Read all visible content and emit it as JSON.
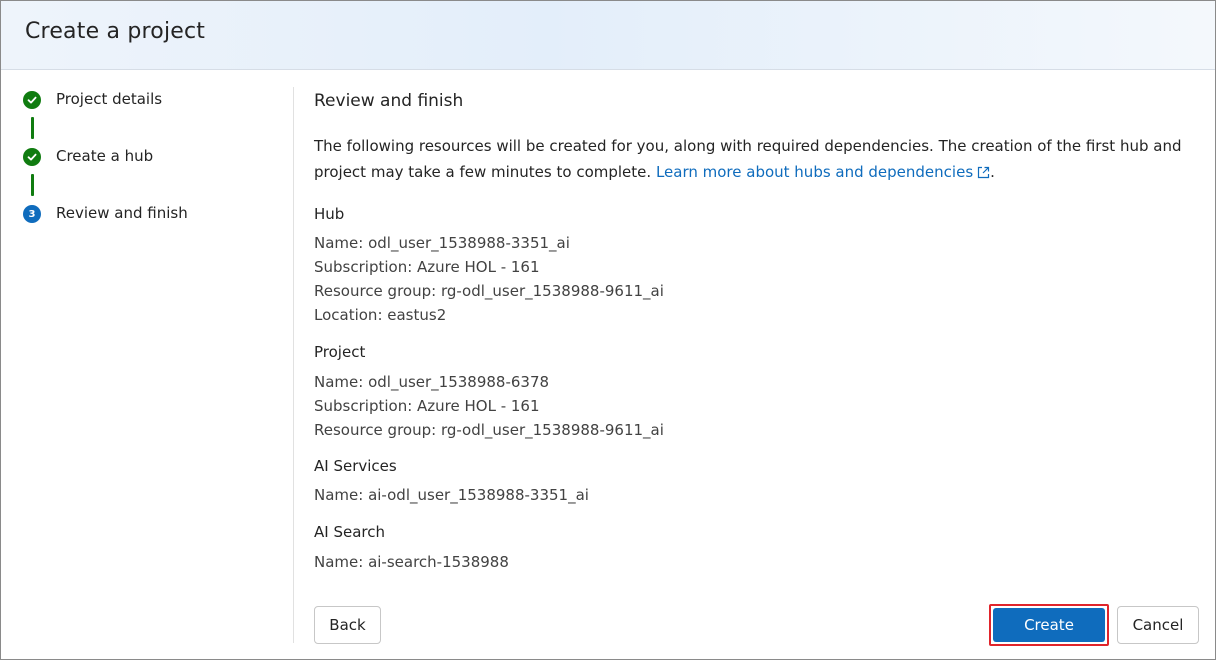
{
  "dialog": {
    "title": "Create a project"
  },
  "stepper": {
    "steps": [
      {
        "label": "Project details",
        "state": "complete",
        "icon": "checkmark-icon"
      },
      {
        "label": "Create a hub",
        "state": "complete",
        "icon": "checkmark-icon"
      },
      {
        "label": "Review and finish",
        "state": "current",
        "number": "3"
      }
    ]
  },
  "review": {
    "title": "Review and finish",
    "description": "The following resources will be created for you, along with required dependencies. The creation of the first hub and project may take a few minutes to complete.",
    "link_text": "Learn more about hubs and dependencies",
    "after_link": ".",
    "hub": {
      "title": "Hub",
      "name": "Name: odl_user_1538988-3351_ai",
      "subscription": "Subscription: Azure HOL - 161",
      "resource_group": "Resource group: rg-odl_user_1538988-9611_ai",
      "location": "Location: eastus2"
    },
    "project": {
      "title": "Project",
      "name": "Name: odl_user_1538988-6378",
      "subscription": "Subscription: Azure HOL - 161",
      "resource_group": "Resource group: rg-odl_user_1538988-9611_ai"
    },
    "ai_services": {
      "title": "AI Services",
      "name": "Name: ai-odl_user_1538988-3351_ai"
    },
    "ai_search": {
      "title": "AI Search",
      "name": "Name: ai-search-1538988"
    }
  },
  "buttons": {
    "back": "Back",
    "create": "Create",
    "cancel": "Cancel"
  },
  "colors": {
    "complete": "#107c10",
    "current": "#0f6cbd",
    "primary": "#0f6cbd",
    "highlight": "#e0242b"
  }
}
